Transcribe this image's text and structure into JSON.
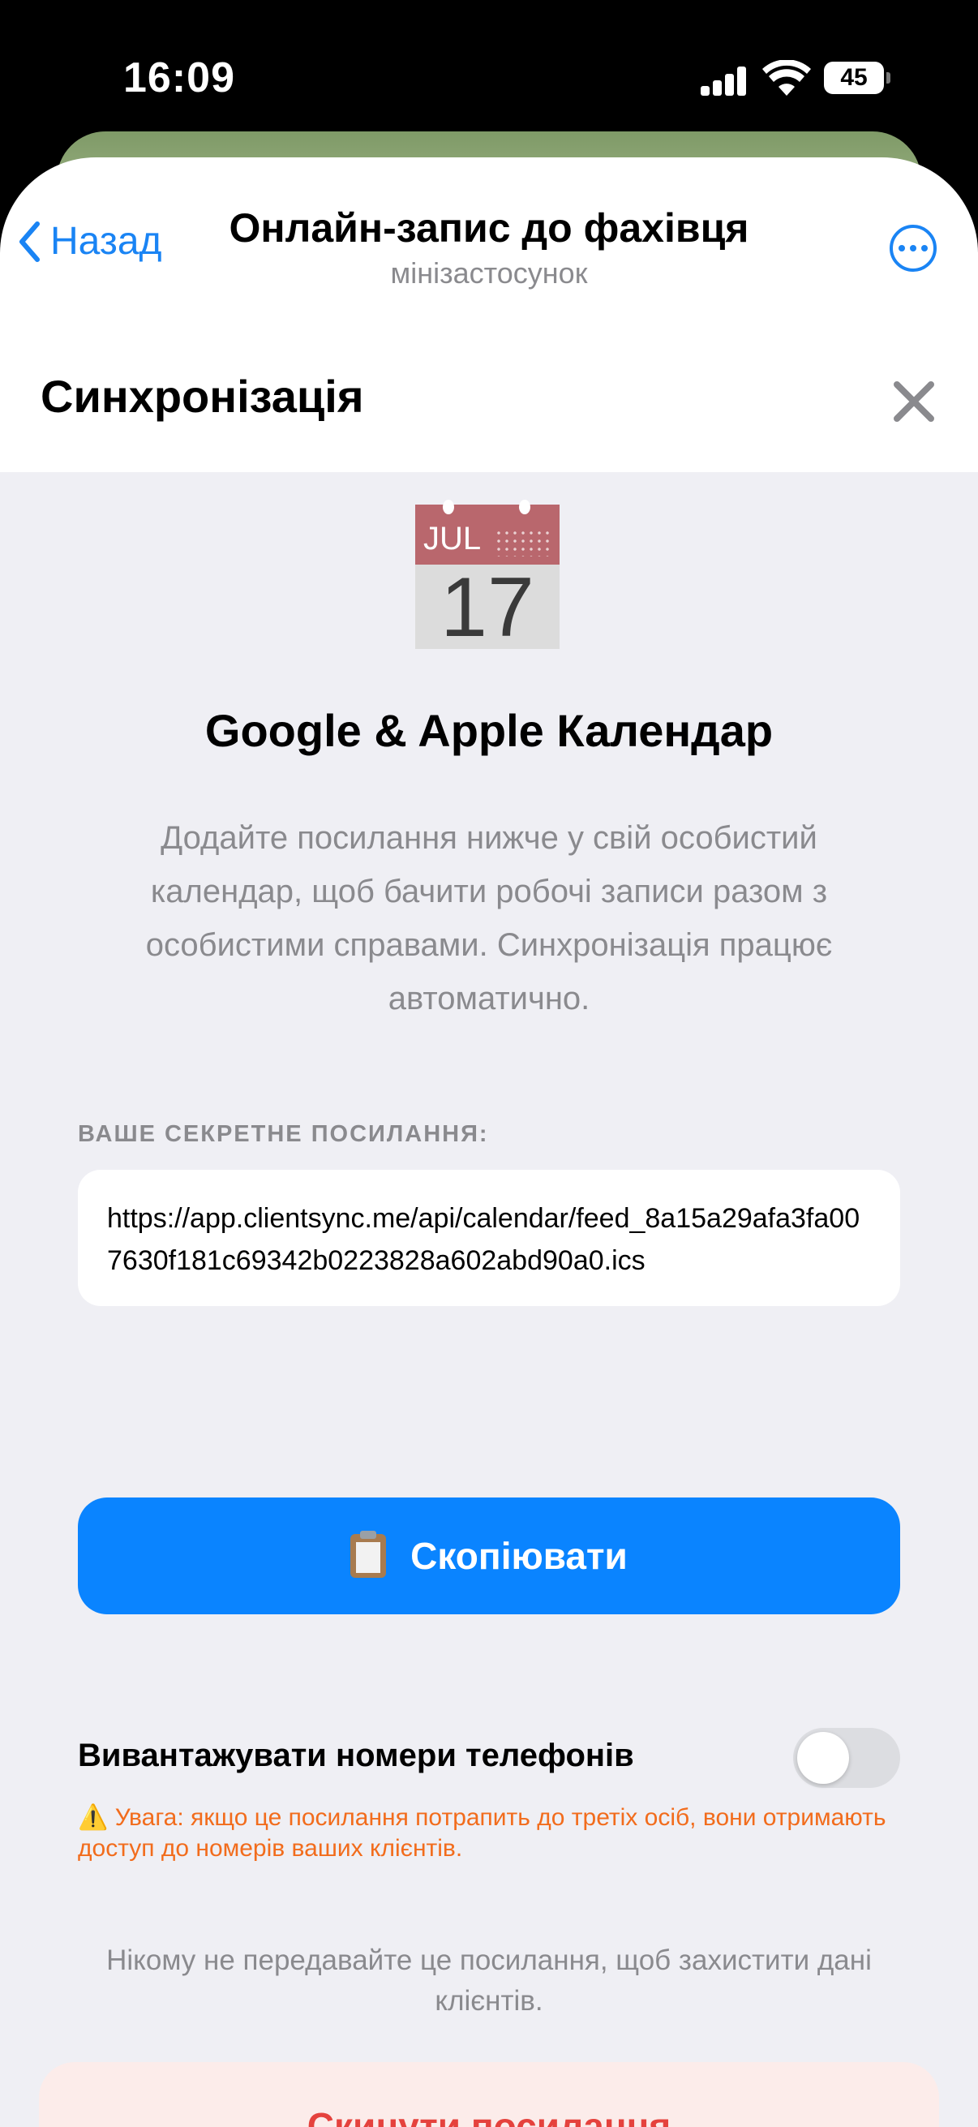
{
  "status_bar": {
    "time": "16:09",
    "battery": "45"
  },
  "nav": {
    "back_label": "Назад",
    "title": "Онлайн-запис до фахівця",
    "subtitle": "мінізастосунок",
    "more_icon": "ellipsis-circle-icon"
  },
  "header": {
    "title": "Синхронізація",
    "close_icon": "close-icon"
  },
  "calendar_icon": {
    "month": "JUL",
    "day": "17"
  },
  "main": {
    "title": "Google & Apple Календар",
    "description": "Додайте посилання нижче у свій особистий календар, щоб бачити робочі записи разом з особистими справами. Синхронізація працює автоматично.",
    "link_label": "ВАШЕ СЕКРЕТНЕ ПОСИЛАННЯ:",
    "link_value": "https://app.clientsync.me/api/calendar/feed_8a15a29afa3fa007630f181c69342b0223828a602abd90a0.ics",
    "copy_label": "Скопіювати",
    "copy_icon": "clipboard-icon"
  },
  "phones": {
    "label": "Вивантажувати номери телефонів",
    "enabled": false,
    "warning": "⚠️ Увага: якщо це посилання потрапить до третіх осіб, вони отримають доступ до номерів ваших клієнтів."
  },
  "footer": {
    "note": "Нікому не передавайте це посилання, щоб захистити дані клієнтів.",
    "reset_label": "Скинути посилання"
  },
  "colors": {
    "accent": "#0a84ff",
    "danger": "#e5423d",
    "warning": "#f26c1c",
    "background": "#efeff4"
  }
}
